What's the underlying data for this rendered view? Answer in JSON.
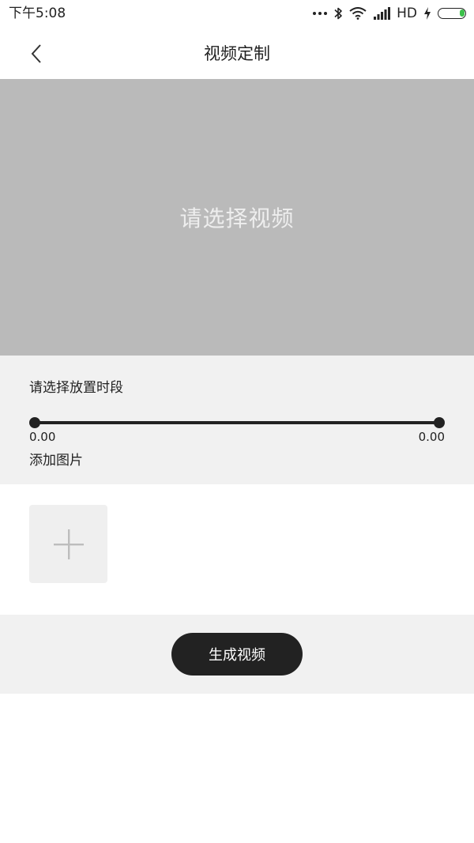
{
  "status_bar": {
    "time": "下午5:08",
    "network": "HD",
    "battery_color": "#3bc14a"
  },
  "nav": {
    "back_icon": "chevron-left-icon",
    "title": "视频定制"
  },
  "video": {
    "placeholder": "请选择视频"
  },
  "time_range": {
    "label": "请选择放置时段",
    "start": "0.00",
    "end": "0.00"
  },
  "images": {
    "label": "添加图片",
    "add_icon": "plus-icon"
  },
  "actions": {
    "generate_label": "生成视频"
  },
  "colors": {
    "video_bg": "#bababa",
    "section_bg": "#f1f1f1",
    "button_bg": "#222222"
  }
}
